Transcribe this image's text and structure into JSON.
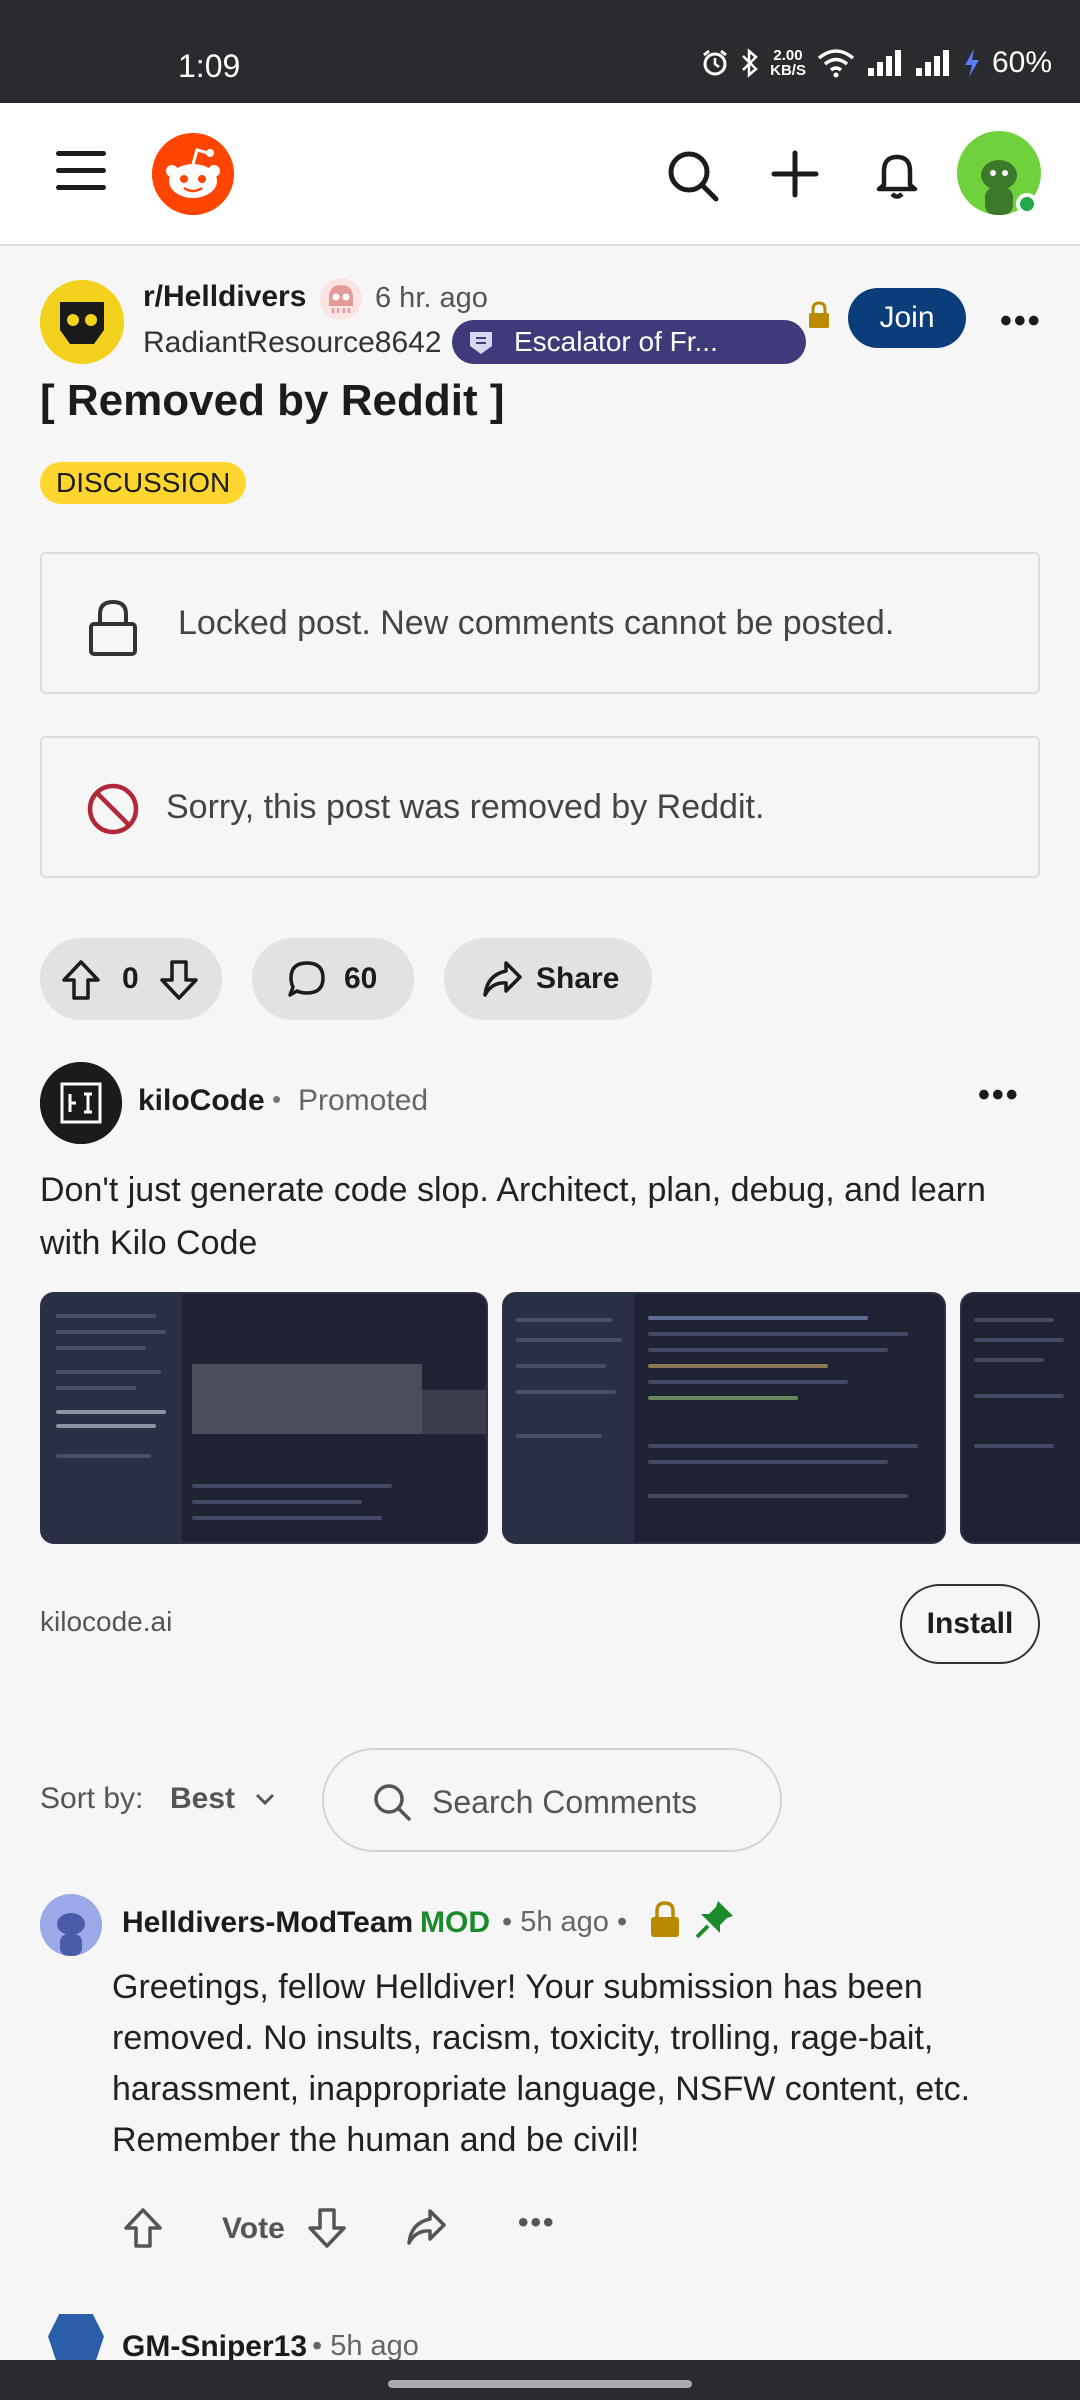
{
  "status_bar": {
    "time": "1:09",
    "net_speed_value": "2.00",
    "net_speed_unit": "KB/S",
    "battery": "60%"
  },
  "top_bar": {
    "icons": [
      "menu-icon",
      "reddit-logo",
      "search-icon",
      "plus-icon",
      "bell-icon",
      "avatar"
    ]
  },
  "post": {
    "subreddit": "r/Helldivers",
    "time_ago": "6 hr. ago",
    "author": "RadiantResource8642",
    "author_flair": "Escalator of Fr...",
    "join_label": "Join",
    "more_label": "•••",
    "title": "[ Removed by Reddit ]",
    "tag": "DISCUSSION",
    "lock_notice": "Locked post. New comments cannot be posted.",
    "removed_notice": "Sorry, this post was removed by Reddit.",
    "vote_count": "0",
    "comment_count": "60",
    "share_label": "Share"
  },
  "promo": {
    "name": "kiloCode",
    "dot": "•",
    "tag": "Promoted",
    "more_label": "•••",
    "text": "Don't just generate code slop. Architect, plan, debug, and learn with Kilo Code",
    "domain": "kilocode.ai",
    "install_label": "Install"
  },
  "sort": {
    "label": "Sort by:",
    "value": "Best",
    "search_placeholder": "Search Comments"
  },
  "comments": [
    {
      "author": "Helldivers-ModTeam",
      "badge": "MOD",
      "meta": "• 5h ago •",
      "body": "Greetings, fellow Helldiver! Your submission has been removed. No insults, racism, toxicity, trolling, rage-bait, harassment, inappropriate language, NSFW content, etc. Remember the human and be civil!",
      "vote_label": "Vote",
      "more_label": "•••"
    },
    {
      "author": "GM-Sniper13",
      "meta": "• 5h ago"
    }
  ],
  "colors": {
    "accent_join": "#0a3d7a",
    "mod_green": "#1a8a2c",
    "discussion_yellow": "#ffd530",
    "lock_gold": "#b88a00",
    "removed_red": "#b0283a",
    "flair_purple": "#3f3a7a"
  }
}
